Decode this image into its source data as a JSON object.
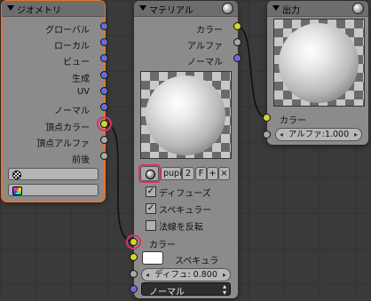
{
  "colors": {
    "vector_socket": "#6b6bd6",
    "color_socket": "#d4d42a",
    "value_socket": "#a8a8a8",
    "highlight": "#e0306a",
    "selected_outline": "#e8732b"
  },
  "geometry_node": {
    "title": "ジオメトリ",
    "outputs": [
      "グローバル",
      "ローカル",
      "ビュー",
      "生成",
      "UV",
      "ノーマル",
      "頂点カラー",
      "頂点アルファ",
      "前後"
    ],
    "field1_icon": "checker-icon",
    "field2_icon": "color-palette-icon"
  },
  "material_node": {
    "title": "マテリアル",
    "outputs": [
      "カラー",
      "アルファ",
      "ノーマル"
    ],
    "material_name": "pupi",
    "users": "2",
    "fake_user": "F",
    "add": "+",
    "remove": "×",
    "checks": [
      {
        "label": "ディフューズ",
        "checked": true
      },
      {
        "label": "スペキュラー",
        "checked": true
      },
      {
        "label": "法線を反転",
        "checked": false
      }
    ],
    "input_color": "カラー",
    "specular_label": "スペキュラ",
    "diffuse_field": "ディフュ: 0.800",
    "normal_select": "ノーマル"
  },
  "output_node": {
    "title": "出力",
    "input_color": "カラー",
    "alpha_field": "アルファ:1.000"
  }
}
